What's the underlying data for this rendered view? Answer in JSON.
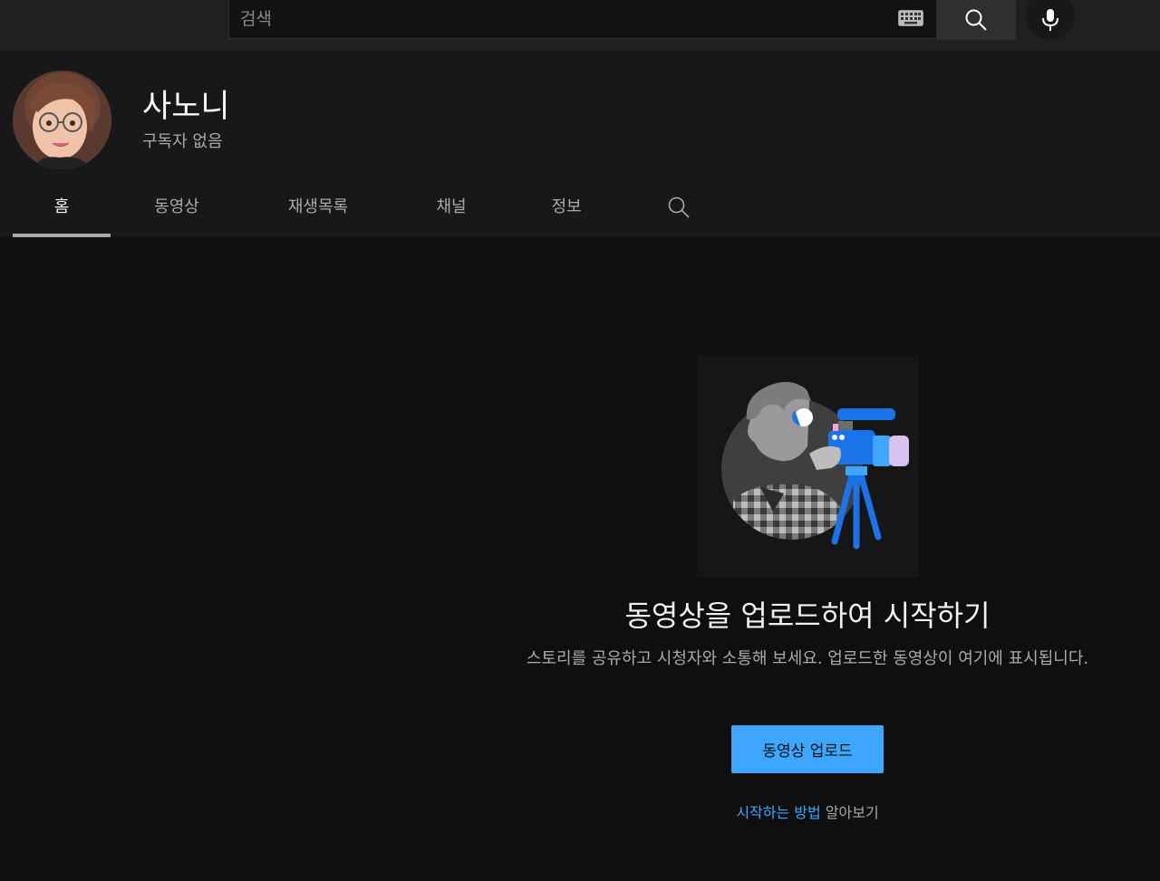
{
  "search": {
    "placeholder": "검색"
  },
  "channel": {
    "name": "사노니",
    "subscribers": "구독자 없음"
  },
  "tabs": [
    {
      "label": "홈",
      "active": true
    },
    {
      "label": "동영상"
    },
    {
      "label": "재생목록"
    },
    {
      "label": "채널"
    },
    {
      "label": "정보"
    }
  ],
  "empty_state": {
    "title": "동영상을 업로드하여 시작하기",
    "description": "스토리를 공유하고 시청자와 소통해 보세요. 업로드한 동영상이 여기에 표시됩니다.",
    "upload_button": "동영상 업로드",
    "learn_link": "시작하는 방법",
    "learn_suffix": " 알아보기"
  },
  "colors": {
    "accent": "#3ea6ff",
    "background": "#0f0f0f",
    "header": "#181818"
  },
  "icons": [
    "keyboard-icon",
    "search-icon",
    "mic-icon"
  ]
}
